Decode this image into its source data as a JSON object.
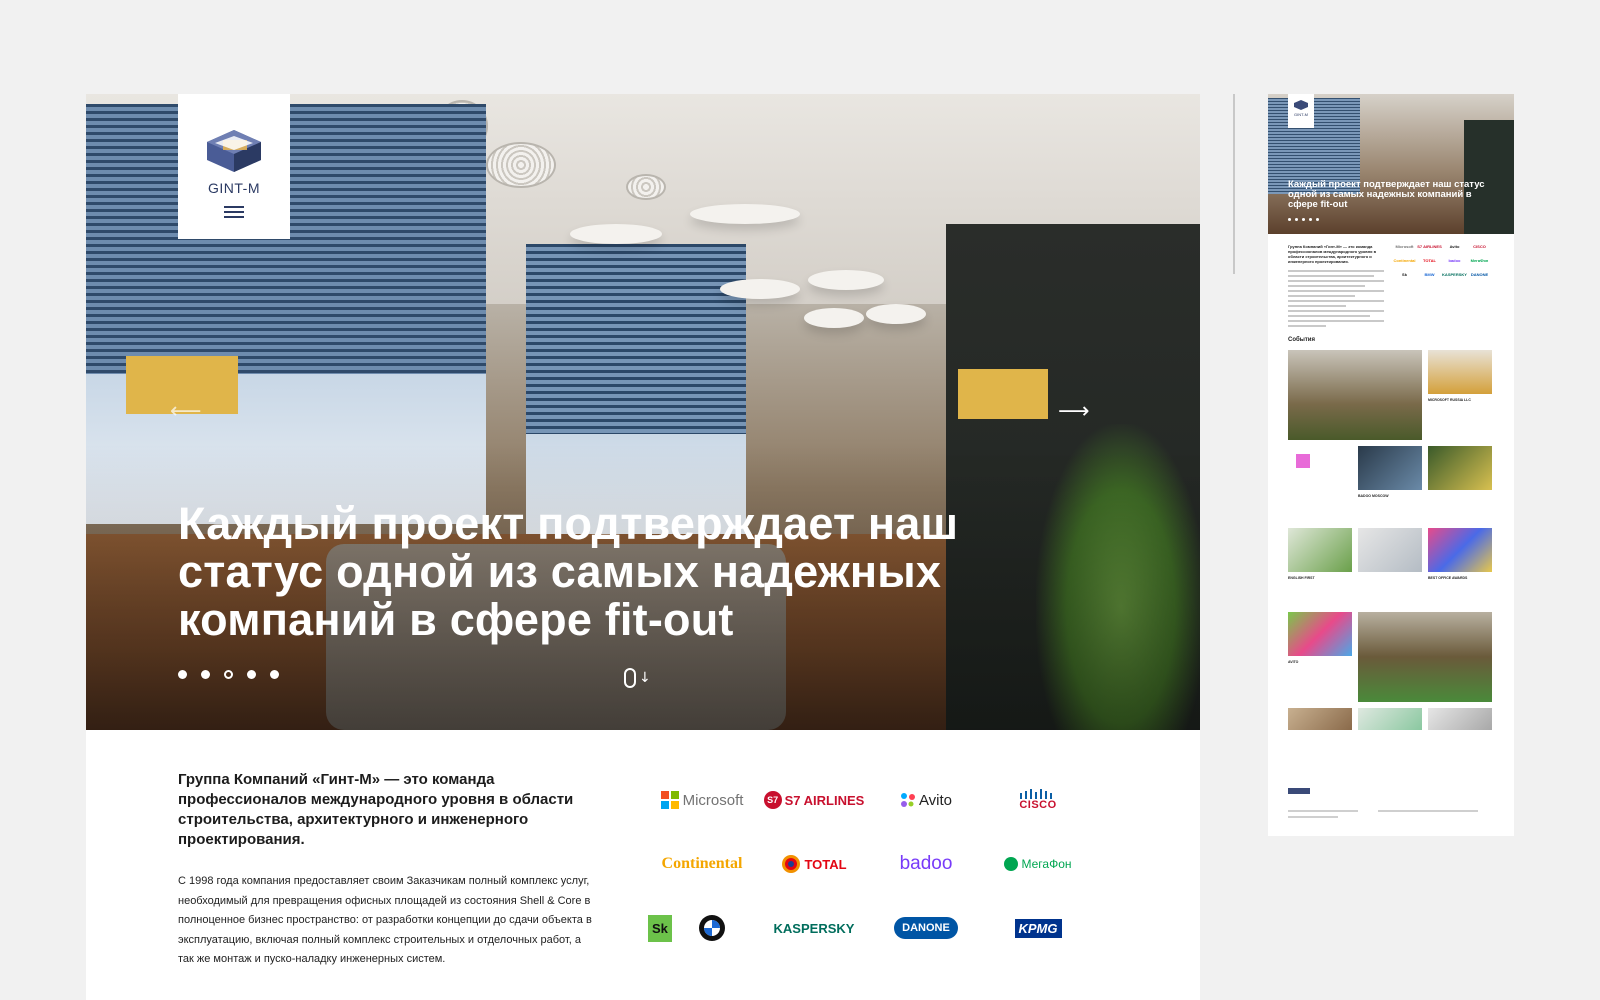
{
  "brand": {
    "name": "GINT-M",
    "primary_color": "#2b3a63",
    "accent_color": "#4a5c96"
  },
  "hero": {
    "title": "Каждый проект подтверждает наш статус одной из самых надежных компаний в сфере fit-out",
    "prev_icon": "arrow-left-icon",
    "next_icon": "arrow-right-icon",
    "slides_total": 5,
    "active_slide": 3,
    "scroll_icon": "mouse-scroll-icon"
  },
  "intro": {
    "lead": "Группа Компаний «Гинт-М» — это команда профессионалов международного уровня в области строительства, архитектурного и инженерного проектирования.",
    "body": "С 1998 года компания предоставляет своим Заказчикам полный комплекс услуг, необходимый для превращения офисных площадей из состояния Shell & Core в полноценное бизнес пространство: от разработки концепции до сдачи объекта в эксплуатацию, включая полный комплекс строительных и отделочных работ, а так же монтаж и пуско-наладку инженерных систем."
  },
  "clients": [
    {
      "name": "Microsoft",
      "color": "#737373"
    },
    {
      "name": "S7 AIRLINES",
      "color": "#c8102e"
    },
    {
      "name": "Avito",
      "color": "#222222"
    },
    {
      "name": "CISCO",
      "color": "#c8102e"
    },
    {
      "name": "Continental",
      "color": "#f4a600"
    },
    {
      "name": "TOTAL",
      "color": "#e30613"
    },
    {
      "name": "badoo",
      "color": "#783bf9"
    },
    {
      "name": "МегаФон",
      "color": "#00a651"
    },
    {
      "name": "Sk",
      "color": "#111111"
    },
    {
      "name": "BMW",
      "color": "#1c69d4"
    },
    {
      "name": "KASPERSKY",
      "color": "#006d5c"
    },
    {
      "name": "DANONE",
      "color": "#0055a5"
    },
    {
      "name": "KPMG",
      "color": "#00338d"
    }
  ],
  "preview": {
    "events_heading": "События",
    "captions": [
      "MICROSOFT RUSSIA LLC",
      "BADOO MOSCOW",
      "ENGLISH FIRST",
      "BEST OFFICE AWARDS",
      "AVITO"
    ]
  }
}
